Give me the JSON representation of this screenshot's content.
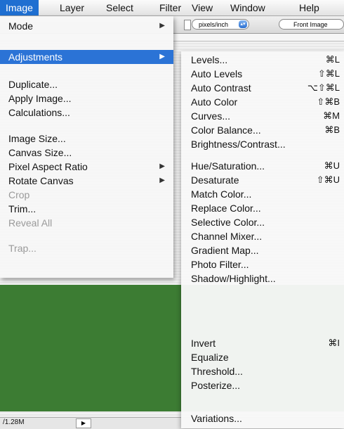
{
  "menubar": {
    "items": [
      "Image",
      "Layer",
      "Select",
      "Filter",
      "View",
      "Window",
      "Help"
    ]
  },
  "app": {
    "units_value": "pixels/inch",
    "front_image_label": "Front Image",
    "status_size": "/1.28M",
    "status_arrow": "▶"
  },
  "image_menu": {
    "items": [
      {
        "label": "Mode",
        "arrow": "▶"
      },
      {
        "label": "Adjustments",
        "arrow": "▶"
      },
      {
        "label": "Duplicate..."
      },
      {
        "label": "Apply Image..."
      },
      {
        "label": "Calculations..."
      },
      {
        "label": "Image Size..."
      },
      {
        "label": "Canvas Size..."
      },
      {
        "label": "Pixel Aspect Ratio",
        "arrow": "▶"
      },
      {
        "label": "Rotate Canvas",
        "arrow": "▶"
      },
      {
        "label": "Crop"
      },
      {
        "label": "Trim..."
      },
      {
        "label": "Reveal All"
      },
      {
        "label": "Trap..."
      }
    ]
  },
  "adjustments_menu": {
    "items": [
      {
        "label": "Levels...",
        "shortcut": "⌘L"
      },
      {
        "label": "Auto Levels",
        "shortcut": "⇧⌘L"
      },
      {
        "label": "Auto Contrast",
        "shortcut": "⌥⇧⌘L"
      },
      {
        "label": "Auto Color",
        "shortcut": "⇧⌘B"
      },
      {
        "label": "Curves...",
        "shortcut": "⌘M"
      },
      {
        "label": "Color Balance...",
        "shortcut": "⌘B"
      },
      {
        "label": "Brightness/Contrast..."
      },
      {
        "label": "Hue/Saturation...",
        "shortcut": "⌘U"
      },
      {
        "label": "Desaturate",
        "shortcut": "⇧⌘U"
      },
      {
        "label": "Match Color..."
      },
      {
        "label": "Replace Color..."
      },
      {
        "label": "Selective Color..."
      },
      {
        "label": "Channel Mixer..."
      },
      {
        "label": "Gradient Map..."
      },
      {
        "label": "Photo Filter..."
      },
      {
        "label": "Shadow/Highlight..."
      },
      {
        "label": "Invert",
        "shortcut": "⌘I"
      },
      {
        "label": "Equalize"
      },
      {
        "label": "Threshold..."
      },
      {
        "label": "Posterize..."
      },
      {
        "label": "Variations..."
      }
    ]
  }
}
